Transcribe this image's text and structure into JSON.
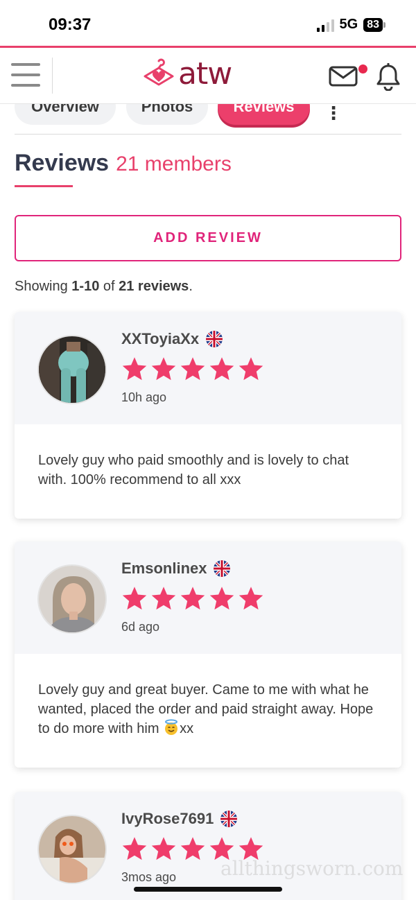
{
  "status_bar": {
    "time": "09:37",
    "network": "5G",
    "battery": "83"
  },
  "header": {
    "logo_text": "atw",
    "notification_dot_color": "#e8294f",
    "icons": [
      "menu-icon",
      "mail-icon",
      "bell-icon"
    ]
  },
  "tabs": [
    {
      "label": "Overview",
      "active": false
    },
    {
      "label": "Photos",
      "active": false
    },
    {
      "label": "Reviews",
      "active": true
    },
    {
      "label": "⋮",
      "active": false
    }
  ],
  "reviews_section": {
    "title": "Reviews",
    "count_label": "21 members",
    "add_review_label": "ADD REVIEW",
    "showing_prefix": "Showing ",
    "showing_range": "1-10",
    "showing_of": " of ",
    "showing_total": "21 reviews",
    "showing_suffix": "."
  },
  "reviews": [
    {
      "name": "XXToyiaXx",
      "rating": 5,
      "time_ago": "10h ago",
      "text": "Lovely guy who paid smoothly and is lovely to chat with. 100% recommend to all xxx"
    },
    {
      "name": "Emsonlinex",
      "rating": 5,
      "time_ago": "6d ago",
      "text_before_emoji": "Lovely guy and great buyer. Came to me with what he wanted, placed the order and paid straight away. Hope to do more with him ",
      "emoji": "smiling-face-with-halo",
      "text_after_emoji": "xx"
    },
    {
      "name": "IvyRose7691",
      "rating": 5,
      "time_ago": "3mos ago"
    }
  ],
  "watermark": "allthingsworn.com",
  "colors": {
    "accent": "#e8406b",
    "brand": "#8e1b3a",
    "button_border": "#e0247a",
    "star": "#ef3d6b",
    "card_top_bg": "#f5f6f9"
  }
}
